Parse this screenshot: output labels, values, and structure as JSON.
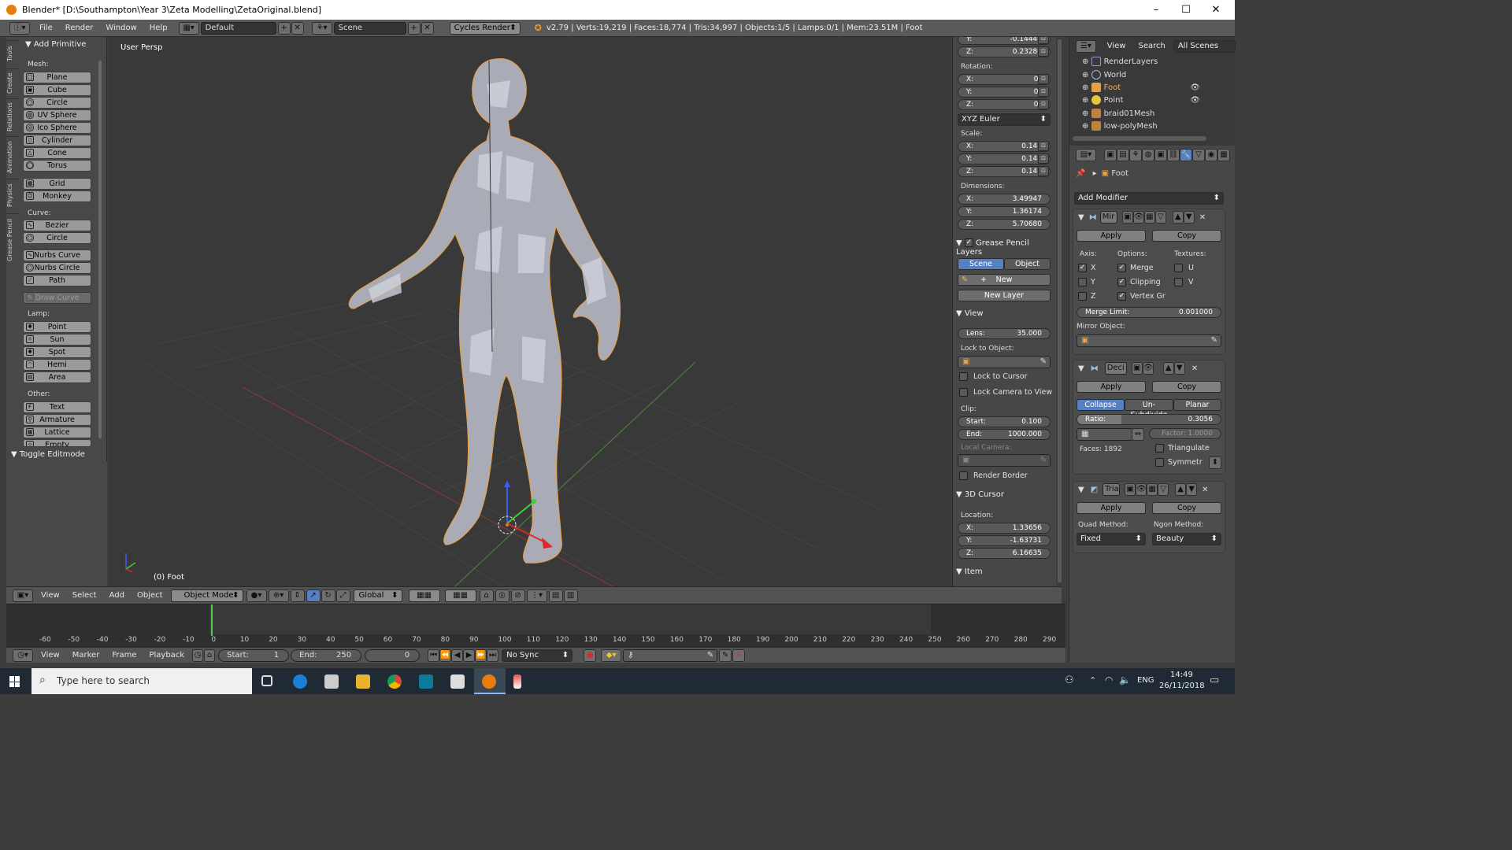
{
  "title": "Blender* [D:\\Southampton\\Year 3\\Zeta Modelling\\ZetaOriginal.blend]",
  "window_controls": {
    "minimize": "–",
    "maximize": "☐",
    "close": "✕"
  },
  "menu": {
    "items": [
      "File",
      "Render",
      "Window",
      "Help"
    ],
    "layout": "Default",
    "scene": "Scene",
    "engine": "Cycles Render",
    "stats": "v2.79 | Verts:19,219 | Faces:18,774 | Tris:34,997 | Objects:1/5 | Lamps:0/1 | Mem:23.51M | Foot"
  },
  "tool_tabs": [
    "Tools",
    "Create",
    "Relations",
    "Animation",
    "Physics",
    "Grease Pencil"
  ],
  "tools": {
    "header": "Add Primitive",
    "mesh_label": "Mesh:",
    "mesh": [
      "Plane",
      "Cube",
      "Circle",
      "UV Sphere",
      "Ico Sphere",
      "Cylinder",
      "Cone",
      "Torus",
      "Grid",
      "Monkey"
    ],
    "curve_label": "Curve:",
    "curve": [
      "Bezier",
      "Circle",
      "Nurbs Curve",
      "Nurbs Circle",
      "Path"
    ],
    "draw_curve": "Draw Curve",
    "lamp_label": "Lamp:",
    "lamp": [
      "Point",
      "Sun",
      "Spot",
      "Hemi",
      "Area"
    ],
    "other_label": "Other:",
    "other": [
      "Text",
      "Armature",
      "Lattice",
      "Empty"
    ],
    "toggle_editmode": "Toggle Editmode"
  },
  "viewport": {
    "view_label": "User Persp",
    "object_label": "(0) Foot"
  },
  "viewport_header": {
    "menus": [
      "View",
      "Select",
      "Add",
      "Object"
    ],
    "mode": "Object Mode",
    "orientation": "Global"
  },
  "npanel": {
    "location": [
      {
        "k": "Y:",
        "v": "-0.14446"
      },
      {
        "k": "Z:",
        "v": "0.23280"
      }
    ],
    "rotation_label": "Rotation:",
    "rotation": [
      {
        "k": "X:",
        "v": "0°"
      },
      {
        "k": "Y:",
        "v": "0°"
      },
      {
        "k": "Z:",
        "v": "0°"
      }
    ],
    "rotation_mode": "XYZ Euler",
    "scale_label": "Scale:",
    "scale": [
      {
        "k": "X:",
        "v": "0.146"
      },
      {
        "k": "Y:",
        "v": "0.146"
      },
      {
        "k": "Z:",
        "v": "0.146"
      }
    ],
    "dimensions_label": "Dimensions:",
    "dimensions": [
      {
        "k": "X:",
        "v": "3.49947"
      },
      {
        "k": "Y:",
        "v": "1.36174"
      },
      {
        "k": "Z:",
        "v": "5.70680"
      }
    ],
    "grease_pencil": "Grease Pencil Layers",
    "gp_scene": "Scene",
    "gp_object": "Object",
    "gp_new": "New",
    "gp_new_layer": "New Layer",
    "view_header": "View",
    "lens_k": "Lens:",
    "lens_v": "35.000",
    "lock_to_object": "Lock to Object:",
    "lock_to_cursor": "Lock to Cursor",
    "lock_camera": "Lock Camera to View",
    "clip_label": "Clip:",
    "clip_start_k": "Start:",
    "clip_start_v": "0.100",
    "clip_end_k": "End:",
    "clip_end_v": "1000.000",
    "local_camera": "Local Camera:",
    "render_border": "Render Border",
    "cursor_header": "3D Cursor",
    "cursor_location": "Location:",
    "cursor": [
      {
        "k": "X:",
        "v": "1.33656"
      },
      {
        "k": "Y:",
        "v": "-1.63731"
      },
      {
        "k": "Z:",
        "v": "6.16635"
      }
    ],
    "item_header": "Item"
  },
  "timeline": {
    "ticks": [
      "-60",
      "-50",
      "-40",
      "-30",
      "-20",
      "-10",
      "0",
      "10",
      "20",
      "30",
      "40",
      "50",
      "60",
      "70",
      "80",
      "90",
      "100",
      "110",
      "120",
      "130",
      "140",
      "150",
      "160",
      "170",
      "180",
      "190",
      "200",
      "210",
      "220",
      "230",
      "240",
      "250",
      "260",
      "270",
      "280",
      "290"
    ],
    "menus": [
      "View",
      "Marker",
      "Frame",
      "Playback"
    ],
    "start_k": "Start:",
    "start_v": "1",
    "end_k": "End:",
    "end_v": "250",
    "current": "0",
    "sync": "No Sync"
  },
  "outliner": {
    "menus": [
      "View",
      "Search"
    ],
    "scenes": "All Scenes",
    "rows": [
      "RenderLayers",
      "World",
      "Foot",
      "Point",
      "braid01Mesh",
      "low-polyMesh"
    ]
  },
  "properties": {
    "object": "Foot",
    "add_modifier": "Add Modifier",
    "mirror": {
      "name": "Mir",
      "apply": "Apply",
      "copy": "Copy",
      "axis_label": "Axis:",
      "options_label": "Options:",
      "textures_label": "Textures:",
      "axes": [
        "X",
        "Y",
        "Z"
      ],
      "options": [
        "Merge",
        "Clipping",
        "Vertex Gr"
      ],
      "textures": [
        "U",
        "V"
      ],
      "merge_limit_k": "Merge Limit:",
      "merge_limit_v": "0.001000",
      "mirror_object": "Mirror Object:"
    },
    "decimate": {
      "name": "Deci",
      "apply": "Apply",
      "copy": "Copy",
      "modes": [
        "Collapse",
        "Un-Subdivide",
        "Planar"
      ],
      "ratio_k": "Ratio:",
      "ratio_v": "0.3056",
      "factor": "Factor: 1.0000",
      "faces": "Faces: 1892",
      "triangulate": "Triangulate",
      "symmetry": "Symmetr"
    },
    "triangulate": {
      "name": "Tria",
      "apply": "Apply",
      "copy": "Copy",
      "quad_label": "Quad Method:",
      "ngon_label": "Ngon Method:",
      "quad": "Fixed",
      "ngon": "Beauty"
    }
  },
  "taskbar": {
    "search_placeholder": "Type here to search",
    "lang": "ENG",
    "time": "14:49",
    "date": "26/11/2018"
  },
  "colors": {
    "accent": "#5680c2",
    "selection": "#f0a35a",
    "ui_dark": "#393939"
  }
}
